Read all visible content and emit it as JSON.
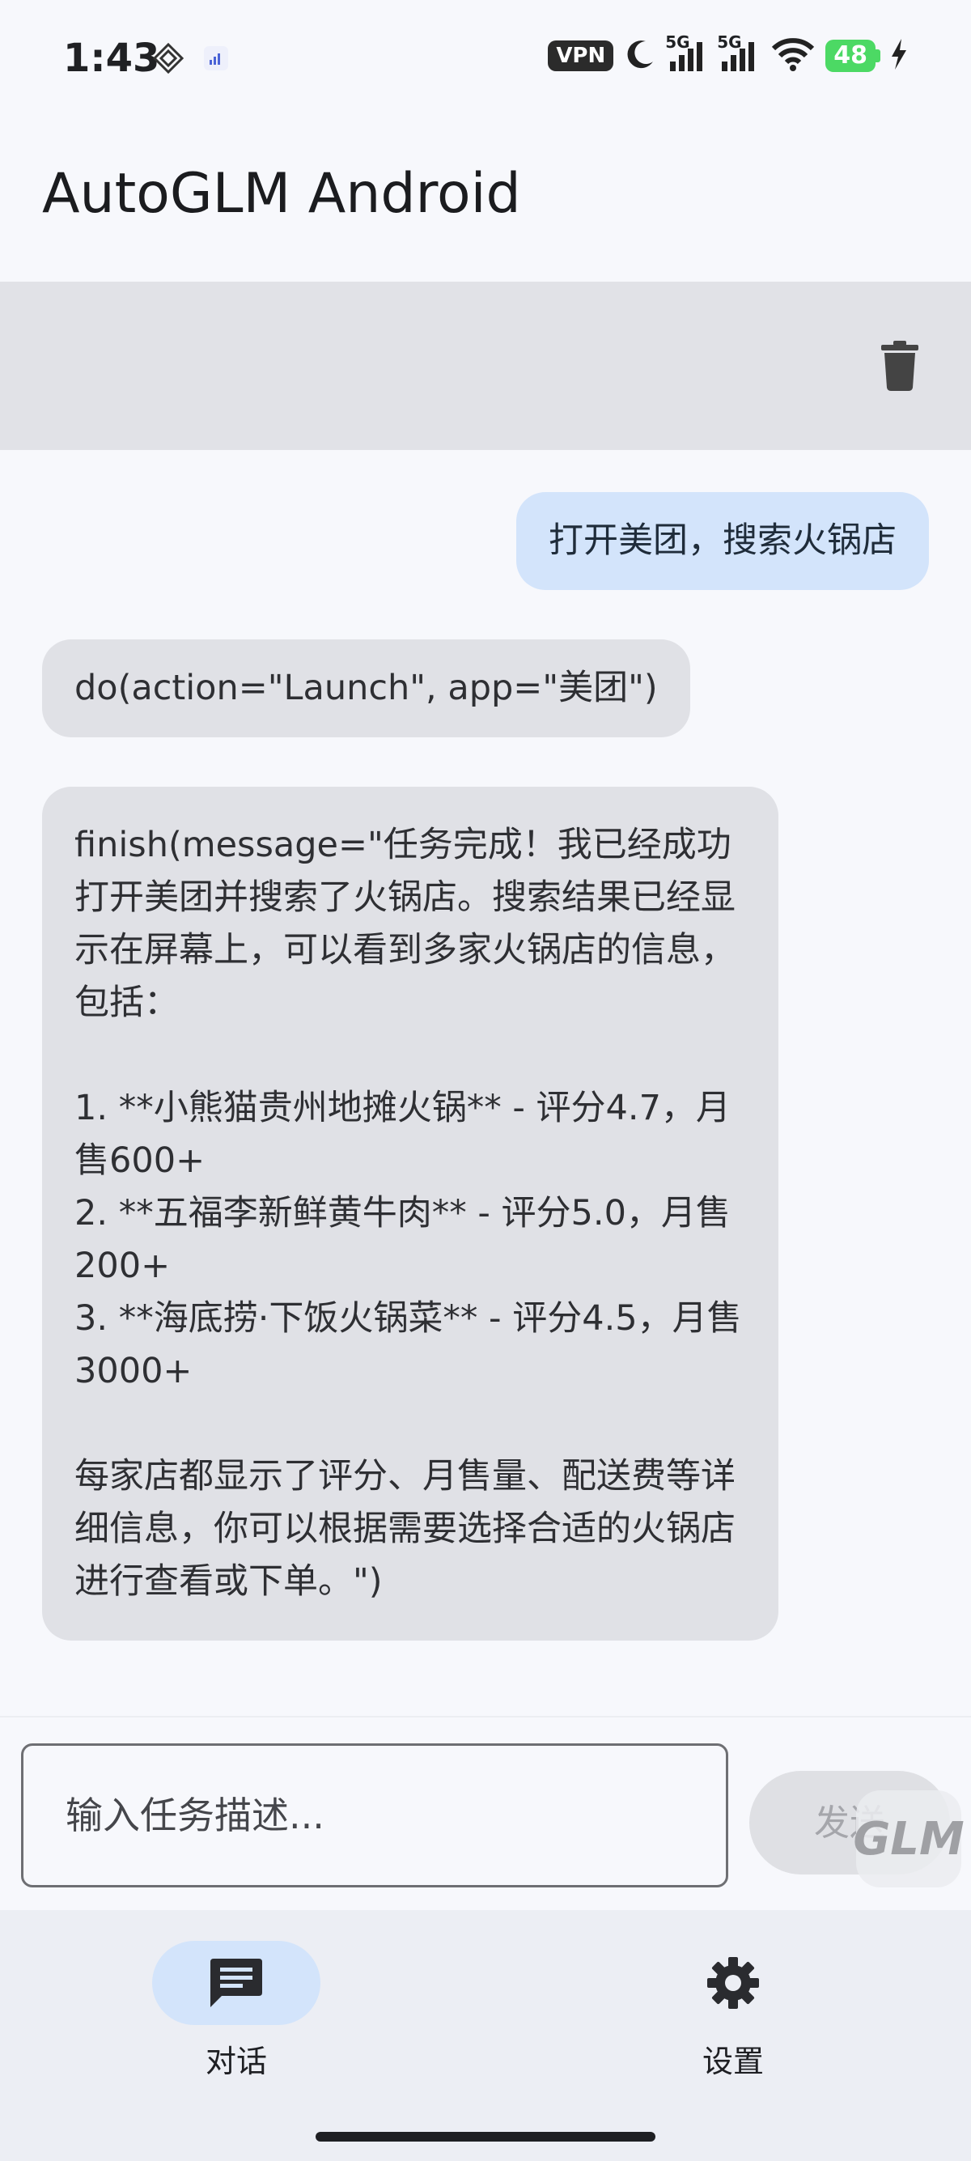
{
  "status_bar": {
    "time": "1:43",
    "vpn": "VPN",
    "net1": "5G",
    "net2": "5G",
    "battery": "48"
  },
  "app": {
    "title": "AutoGLM Android"
  },
  "toolbar": {
    "clear_icon": "trash-icon"
  },
  "messages": [
    {
      "role": "user",
      "text": "打开美团，搜索火锅店"
    },
    {
      "role": "assistant",
      "text": "do(action=\"Launch\", app=\"美团\")"
    },
    {
      "role": "assistant",
      "text": "finish(message=\"任务完成！我已经成功打开美团并搜索了火锅店。搜索结果已经显示在屏幕上，可以看到多家火锅店的信息，包括：\n\n1. **小熊猫贵州地摊火锅** - 评分4.7，月售600+\n2. **五福李新鲜黄牛肉** - 评分5.0，月售200+\n3. **海底捞·下饭火锅菜** - 评分4.5，月售3000+\n\n每家店都显示了评分、月售量、配送费等详细信息，你可以根据需要选择合适的火锅店进行查看或下单。\")"
    }
  ],
  "input": {
    "placeholder": "输入任务描述...",
    "send_label": "发送",
    "watermark": "GLM"
  },
  "nav": {
    "items": [
      {
        "label": "对话",
        "icon": "chat-icon",
        "active": true
      },
      {
        "label": "设置",
        "icon": "gear-icon",
        "active": false
      }
    ]
  },
  "colors": {
    "user_bubble": "#d3e4fb",
    "assistant_bubble": "#e0e1e6",
    "toolbar": "#e1e2e7",
    "nav_active": "#d3e4fb"
  }
}
